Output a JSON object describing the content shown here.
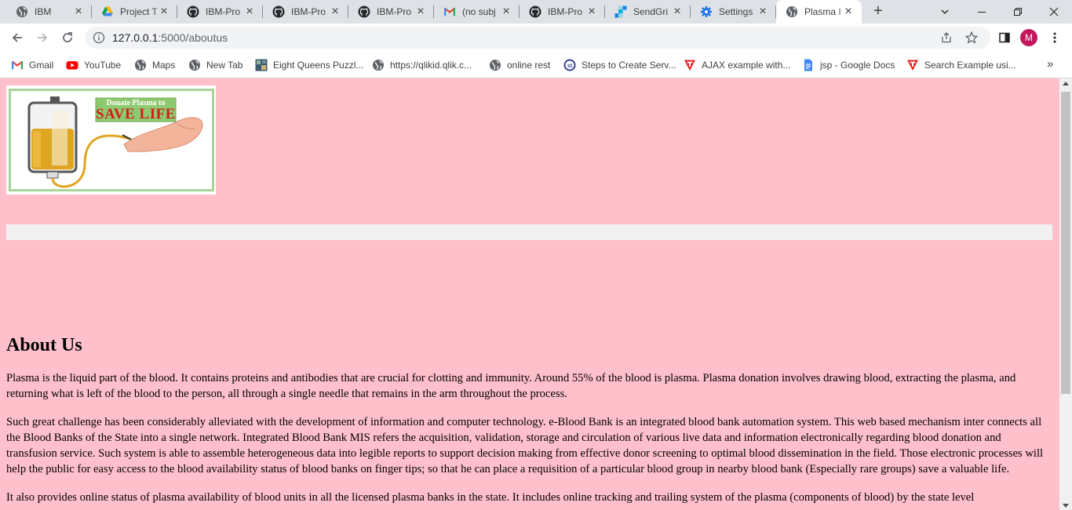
{
  "browser": {
    "tabs": [
      {
        "title": "IBM",
        "icon": "globe-icon",
        "active": false
      },
      {
        "title": "Project T",
        "icon": "google-drive-icon",
        "active": false
      },
      {
        "title": "IBM-Pro",
        "icon": "github-icon",
        "active": false
      },
      {
        "title": "IBM-Pro",
        "icon": "github-icon",
        "active": false
      },
      {
        "title": "IBM-Pro",
        "icon": "github-icon",
        "active": false
      },
      {
        "title": "(no subj",
        "icon": "gmail-icon",
        "active": false
      },
      {
        "title": "IBM-Pro",
        "icon": "github-icon",
        "active": false
      },
      {
        "title": "SendGri",
        "icon": "sendgrid-icon",
        "active": false
      },
      {
        "title": "Settings",
        "icon": "settings-gear-icon",
        "active": false
      },
      {
        "title": "Plasma I",
        "icon": "globe-icon",
        "active": true
      }
    ],
    "address": {
      "host": "127.0.0.1",
      "path": ":5000/aboutus"
    },
    "profile_initial": "M",
    "bookmarks": [
      {
        "label": "Gmail",
        "icon": "gmail-icon"
      },
      {
        "label": "YouTube",
        "icon": "youtube-icon"
      },
      {
        "label": "Maps",
        "icon": "globe-icon"
      },
      {
        "label": "New Tab",
        "icon": "globe-icon"
      },
      {
        "label": "Eight Queens Puzzl...",
        "icon": "image-thumb-icon"
      },
      {
        "label": "https://qlikid.qlik.c...",
        "icon": "globe-icon"
      },
      {
        "label": "online rest",
        "icon": "globe-icon"
      },
      {
        "label": "Steps to Create Serv...",
        "icon": "st-icon"
      },
      {
        "label": "AJAX example with...",
        "icon": "red-t-icon"
      },
      {
        "label": "jsp - Google Docs",
        "icon": "google-docs-icon"
      },
      {
        "label": "Search Example usi...",
        "icon": "red-t-icon"
      }
    ]
  },
  "page": {
    "background": "#ffc0cb",
    "banner": {
      "headline_small": "Donate Plasma to",
      "headline_big": "SAVE LIFE"
    },
    "about": {
      "title": "About Us",
      "paragraphs": [
        "Plasma is the liquid part of the blood. It contains proteins and antibodies that are crucial for clotting and immunity. Around 55% of the blood is plasma. Plasma donation involves drawing blood, extracting the plasma, and returning what is left of the blood to the person, all through a single needle that remains in the arm throughout the process.",
        "Such great challenge has been considerably alleviated with the development of information and computer technology. e-Blood Bank is an integrated blood bank automation system. This web based mechanism inter connects all the Blood Banks of the State into a single network. Integrated Blood Bank MIS refers the acquisition, validation, storage and circulation of various live data and information electronically regarding blood donation and transfusion service. Such system is able to assemble heterogeneous data into legible reports to support decision making from effective donor screening to optimal blood dissemination in the field. Those electronic processes will help the public for easy access to the blood availability status of blood banks on finger tips; so that he can place a requisition of a particular blood group in nearby blood bank (Especially rare groups) save a valuable life.",
        "It also provides online status of plasma availability of blood units in all the licensed plasma banks in the state. It includes online tracking and trailing system of the plasma (components of blood) by the state level"
      ]
    }
  }
}
